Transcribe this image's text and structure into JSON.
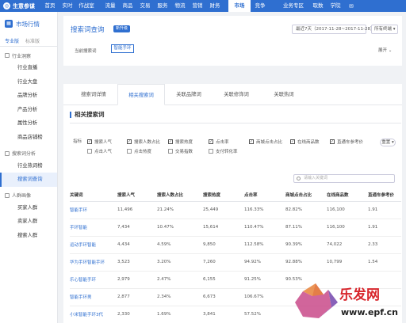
{
  "topnav": {
    "brand": "生意参谋",
    "items": [
      "首页",
      "实时",
      "作战室",
      "流量",
      "商品",
      "交易",
      "服务",
      "物流",
      "营销",
      "财务",
      "市场",
      "竞争",
      "业务专区",
      "取数",
      "学院"
    ],
    "active": "市场"
  },
  "sidebar": {
    "title": "市场行情",
    "tabs": [
      "专业版",
      "标准版"
    ],
    "sections": [
      {
        "label": "行业洞察",
        "items": [
          "行业直播",
          "行业大盘",
          "品牌分析",
          "产品分析",
          "属性分析",
          "商品店铺榜"
        ]
      },
      {
        "label": "搜索词分析",
        "items": [
          "行业热词榜",
          "搜索词查询"
        ]
      },
      {
        "label": "人群画像",
        "items": [
          "买家人群",
          "卖家人群",
          "搜索人群"
        ]
      }
    ],
    "active_item": "搜索词查询"
  },
  "header": {
    "title": "搜索词查询",
    "pill": "新升级",
    "date_range": "最近7天（2017-11-28~2017-11-28）",
    "device": "所有终端",
    "keyword_label": "当前搜索词",
    "keyword": "智能手环",
    "expand": "展开"
  },
  "tabs": [
    "搜索词详情",
    "相关搜索词",
    "关联品牌词",
    "关联修饰词",
    "关联热词"
  ],
  "active_tab": "相关搜索词",
  "section_title": "相关搜索词",
  "metrics": {
    "label": "指标",
    "items": [
      {
        "label": "搜索人气",
        "checked": true
      },
      {
        "label": "搜索人数占比",
        "checked": true
      },
      {
        "label": "搜索热度",
        "checked": true
      },
      {
        "label": "点击率",
        "checked": true
      },
      {
        "label": "商城点击占比",
        "checked": true
      },
      {
        "label": "在线商品数",
        "checked": true
      },
      {
        "label": "直通车参考价",
        "checked": true
      },
      {
        "label": "点击人气",
        "checked": false
      },
      {
        "label": "点击热度",
        "checked": false
      },
      {
        "label": "交易指数",
        "checked": false
      },
      {
        "label": "支付转化率",
        "checked": false
      }
    ],
    "reset": "重置"
  },
  "search": {
    "placeholder": "请输入关键词"
  },
  "table": {
    "headers": [
      "关键词",
      "搜索人气",
      "搜索人数占比",
      "搜索热度",
      "点击率",
      "商城点击占比",
      "在线商品数",
      "直通车参考价"
    ],
    "rows": [
      [
        "智能手环",
        "11,496",
        "21.24%",
        "25,449",
        "116.33%",
        "82.82%",
        "116,100",
        "1.91"
      ],
      [
        "手环智能",
        "7,434",
        "10.47%",
        "15,614",
        "110.47%",
        "87.11%",
        "116,100",
        "1.91"
      ],
      [
        "运动手环智能",
        "4,434",
        "4.59%",
        "9,850",
        "112.58%",
        "90.39%",
        "74,022",
        "2.33"
      ],
      [
        "华为手环智能手环",
        "3,523",
        "3.20%",
        "7,260",
        "94.92%",
        "92.88%",
        "10,799",
        "1.54"
      ],
      [
        "乐心智能手环",
        "2,979",
        "2.47%",
        "6,155",
        "91.25%",
        "90.53%",
        "",
        ""
      ],
      [
        "智能手环男",
        "2,877",
        "2.34%",
        "6,673",
        "106.67%",
        "",
        "",
        ""
      ],
      [
        "小米智能手环3代",
        "2,330",
        "1.69%",
        "3,841",
        "57.52%",
        "",
        "",
        ""
      ]
    ]
  },
  "watermark": {
    "text1": "乐发网",
    "text2": "www.epf.cn"
  }
}
